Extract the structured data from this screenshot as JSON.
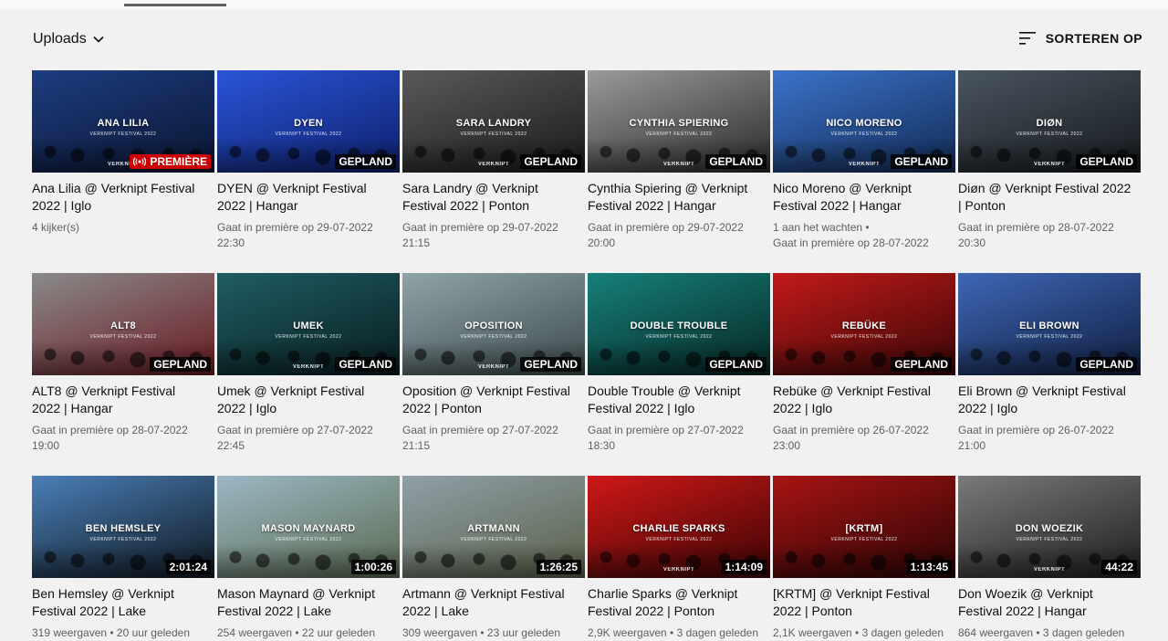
{
  "section": {
    "title": "Uploads",
    "sort_label": "SORTEREN OP"
  },
  "videos": [
    {
      "title": "Ana Lilia @ Verknipt Festival 2022 | Iglo",
      "thumb_title": "ANA LILIA",
      "thumb_sub": "VERKNIPT FESTIVAL 2022",
      "logo": "VERKNIPT",
      "badge": "PREMIÈRE",
      "badge_type": "live",
      "meta1": "4 kijker(s)",
      "meta2": "",
      "color1": "#1d3d80",
      "color2": "#0b1530"
    },
    {
      "title": "DYEN @ Verknipt Festival 2022 | Hangar",
      "thumb_title": "DYEN",
      "thumb_sub": "VERKNIPT FESTIVAL 2022",
      "logo": "",
      "badge": "GEPLAND",
      "badge_type": "plain",
      "meta1": "Gaat in première op 29-07-2022",
      "meta2": "22:30",
      "color1": "#2a55d8",
      "color2": "#0d1f6a"
    },
    {
      "title": "Sara Landry @ Verknipt Festival 2022 | Ponton",
      "thumb_title": "SARA LANDRY",
      "thumb_sub": "VERKNIPT FESTIVAL 2022",
      "logo": "VERKNIPT",
      "badge": "GEPLAND",
      "badge_type": "plain",
      "meta1": "Gaat in première op 29-07-2022",
      "meta2": "21:15",
      "color1": "#5a5a5a",
      "color2": "#1a1a1a"
    },
    {
      "title": "Cynthia Spiering @ Verknipt Festival 2022 | Hangar",
      "thumb_title": "CYNTHIA SPIERING",
      "thumb_sub": "VERKNIPT FESTIVAL 2022",
      "logo": "VERKNIPT",
      "badge": "GEPLAND",
      "badge_type": "plain",
      "meta1": "Gaat in première op 29-07-2022",
      "meta2": "20:00",
      "color1": "#9a9a9a",
      "color2": "#2a2a2a"
    },
    {
      "title": "Nico Moreno @ Verknipt Festival 2022 | Hangar",
      "thumb_title": "NICO MORENO",
      "thumb_sub": "VERKNIPT FESTIVAL 2022",
      "logo": "VERKNIPT",
      "badge": "GEPLAND",
      "badge_type": "plain",
      "meta1": "1 aan het wachten •",
      "meta2": "Gaat in première op 28-07-2022",
      "color1": "#3b73c9",
      "color2": "#122a55"
    },
    {
      "title": "Diøn @ Verknipt Festival 2022 | Ponton",
      "thumb_title": "DIØN",
      "thumb_sub": "VERKNIPT FESTIVAL 2022",
      "logo": "VERKNIPT",
      "badge": "GEPLAND",
      "badge_type": "plain",
      "meta1": "Gaat in première op 28-07-2022",
      "meta2": "20:30",
      "color1": "#4a5560",
      "color2": "#15191d"
    },
    {
      "title": "ALT8 @ Verknipt Festival 2022 | Hangar",
      "thumb_title": "ALT8",
      "thumb_sub": "VERKNIPT FESTIVAL 2022",
      "logo": "",
      "badge": "GEPLAND",
      "badge_type": "plain",
      "meta1": "Gaat in première op 28-07-2022",
      "meta2": "19:00",
      "color1": "#8a8a8a",
      "color2": "#6a1a22"
    },
    {
      "title": "Umek @ Verknipt Festival 2022 | Iglo",
      "thumb_title": "UMEK",
      "thumb_sub": "VERKNIPT FESTIVAL 2022",
      "logo": "VERKNIPT",
      "badge": "GEPLAND",
      "badge_type": "plain",
      "meta1": "Gaat in première op 27-07-2022",
      "meta2": "22:45",
      "color1": "#1f5d62",
      "color2": "#081d20"
    },
    {
      "title": "Oposition @ Verknipt Festival 2022 | Ponton",
      "thumb_title": "OPOSITION",
      "thumb_sub": "VERKNIPT FESTIVAL 2022",
      "logo": "VERKNIPT",
      "badge": "GEPLAND",
      "badge_type": "plain",
      "meta1": "Gaat in première op 27-07-2022",
      "meta2": "21:15",
      "color1": "#8fa4a8",
      "color2": "#3c4a4c"
    },
    {
      "title": "Double Trouble @ Verknipt Festival 2022 | Iglo",
      "thumb_title": "DOUBLE TROUBLE",
      "thumb_sub": "VERKNIPT FESTIVAL 2022",
      "logo": "",
      "badge": "GEPLAND",
      "badge_type": "plain",
      "meta1": "Gaat in première op 27-07-2022",
      "meta2": "18:30",
      "color1": "#17807a",
      "color2": "#062624"
    },
    {
      "title": "Rebüke @ Verknipt Festival 2022 | Iglo",
      "thumb_title": "REBÜKE",
      "thumb_sub": "VERKNIPT FESTIVAL 2022",
      "logo": "",
      "badge": "GEPLAND",
      "badge_type": "plain",
      "meta1": "Gaat in première op 26-07-2022",
      "meta2": "23:00",
      "color1": "#c21a1a",
      "color2": "#3a0606"
    },
    {
      "title": "Eli Brown @ Verknipt Festival 2022 | Iglo",
      "thumb_title": "ELI BROWN",
      "thumb_sub": "VERKNIPT FESTIVAL 2022",
      "logo": "",
      "badge": "GEPLAND",
      "badge_type": "plain",
      "meta1": "Gaat in première op 26-07-2022",
      "meta2": "21:00",
      "color1": "#3f66b5",
      "color2": "#0f1f40"
    },
    {
      "title": "Ben Hemsley @ Verknipt Festival 2022 | Lake",
      "thumb_title": "BEN HEMSLEY",
      "thumb_sub": "VERKNIPT FESTIVAL 2022",
      "logo": "",
      "badge": "2:01:24",
      "badge_type": "plain",
      "meta1": "319 weergaven • 20 uur geleden",
      "meta2": "",
      "color1": "#4a7fb8",
      "color2": "#101820"
    },
    {
      "title": "Mason Maynard @ Verknipt Festival 2022 | Lake",
      "thumb_title": "MASON MAYNARD",
      "thumb_sub": "VERKNIPT FESTIVAL 2022",
      "logo": "",
      "badge": "1:00:26",
      "badge_type": "plain",
      "meta1": "254 weergaven • 22 uur geleden",
      "meta2": "",
      "color1": "#9bb7c4",
      "color2": "#5a6a50"
    },
    {
      "title": "Artmann @ Verknipt Festival 2022 | Lake",
      "thumb_title": "ARTMANN",
      "thumb_sub": "VERKNIPT FESTIVAL 2022",
      "logo": "",
      "badge": "1:26:25",
      "badge_type": "plain",
      "meta1": "309 weergaven • 23 uur geleden",
      "meta2": "",
      "color1": "#8fa0a8",
      "color2": "#5a6048"
    },
    {
      "title": "Charlie Sparks @ Verknipt Festival 2022 | Ponton",
      "thumb_title": "CHARLIE SPARKS",
      "thumb_sub": "VERKNIPT FESTIVAL 2022",
      "logo": "VERKNIPT",
      "badge": "1:14:09",
      "badge_type": "plain",
      "meta1": "2,9K weergaven • 3 dagen geleden",
      "meta2": "",
      "color1": "#d01818",
      "color2": "#3a0404"
    },
    {
      "title": "[KRTM] @ Verknipt Festival 2022 | Ponton",
      "thumb_title": "[KRTM]",
      "thumb_sub": "VERKNIPT FESTIVAL 2022",
      "logo": "",
      "badge": "1:13:45",
      "badge_type": "plain",
      "meta1": "2,1K weergaven • 3 dagen geleden",
      "meta2": "",
      "color1": "#a81414",
      "color2": "#2a0404"
    },
    {
      "title": "Don Woezik @ Verknipt Festival 2022 | Hangar",
      "thumb_title": "DON WOEZIK",
      "thumb_sub": "VERKNIPT FESTIVAL 2022",
      "logo": "VERKNIPT",
      "badge": "44:22",
      "badge_type": "plain",
      "meta1": "864 weergaven • 3 dagen geleden",
      "meta2": "",
      "color1": "#7a7a7a",
      "color2": "#1e1e1e"
    }
  ]
}
